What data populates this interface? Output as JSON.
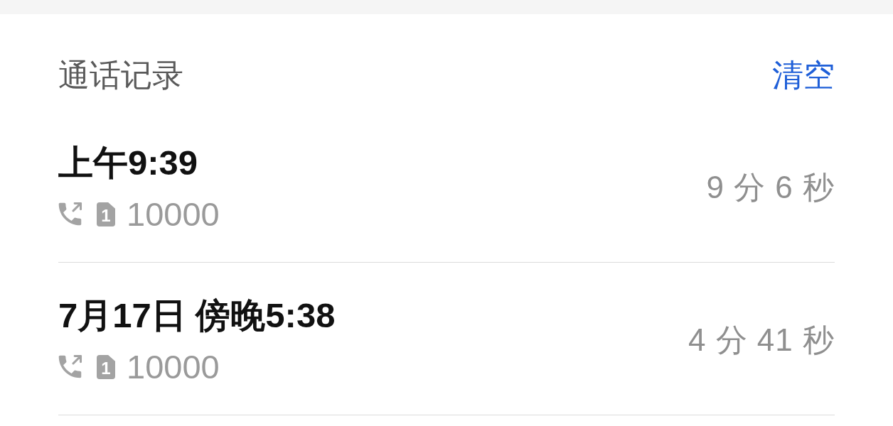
{
  "header": {
    "title": "通话记录",
    "clear_button": "清空"
  },
  "calls": [
    {
      "time": "上午9:39",
      "kind": "outgoing",
      "sim": "1",
      "number": "10000",
      "duration": "9 分 6 秒"
    },
    {
      "time": "7月17日 傍晚5:38",
      "kind": "outgoing",
      "sim": "1",
      "number": "10000",
      "duration": "4 分 41 秒"
    }
  ]
}
